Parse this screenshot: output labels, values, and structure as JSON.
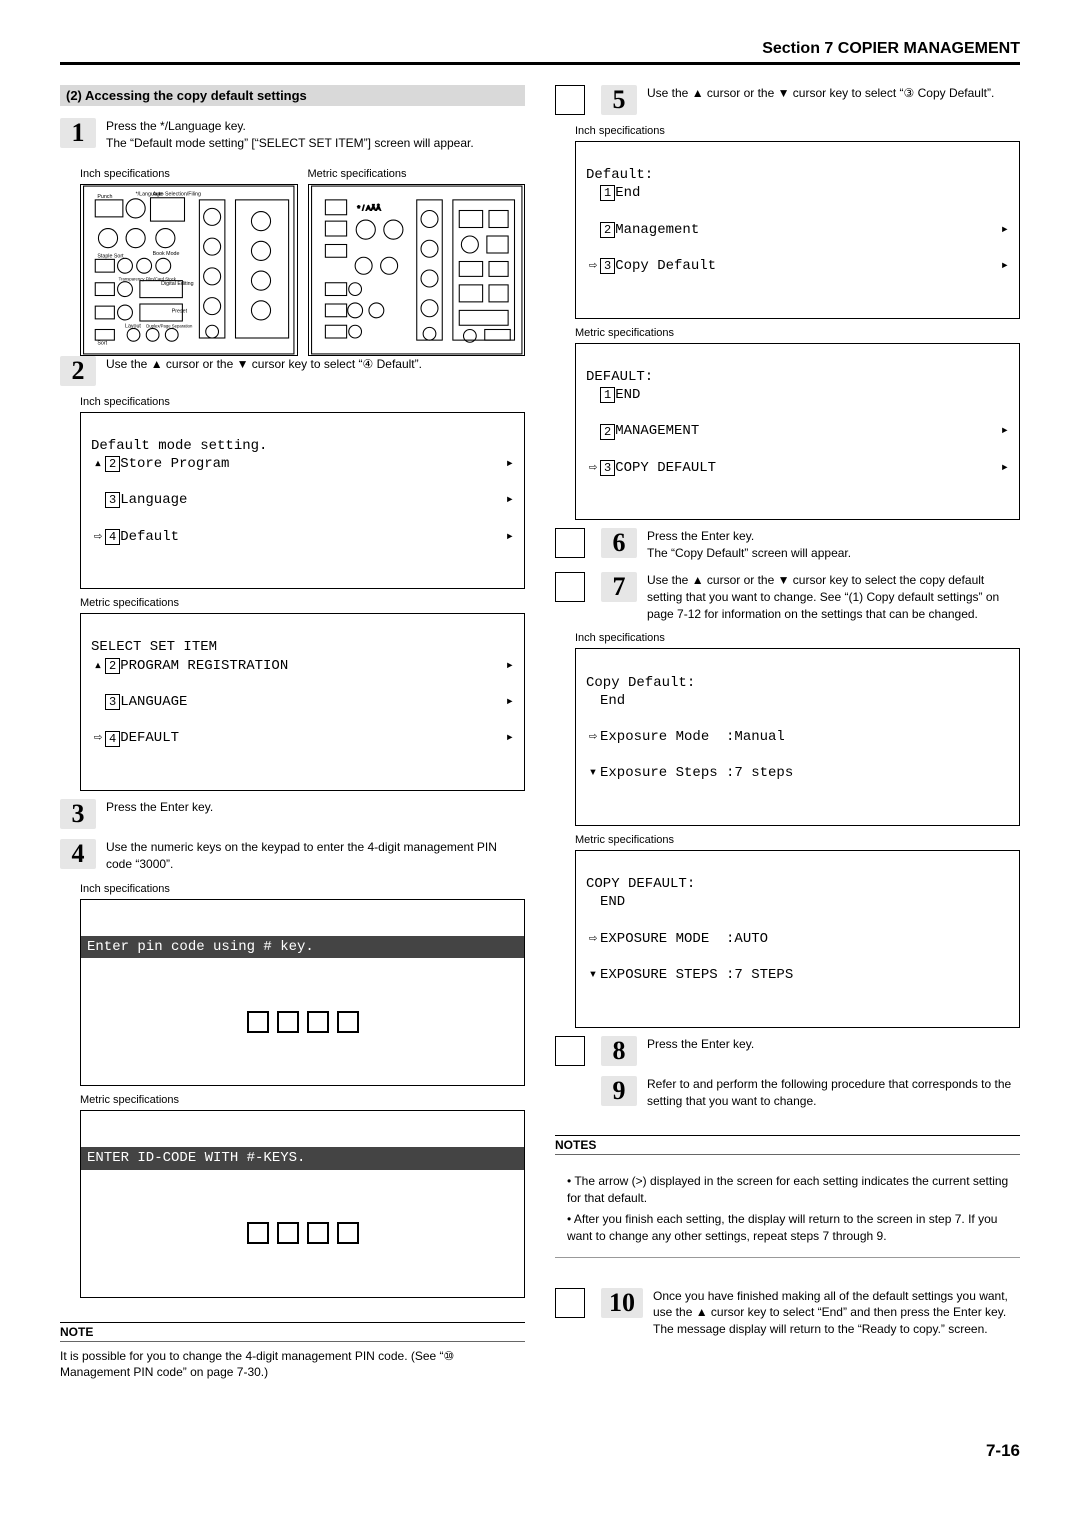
{
  "header": {
    "section": "Section 7  COPIER MANAGEMENT"
  },
  "left": {
    "subsection": "(2)    Accessing the copy default settings",
    "step1": {
      "num": "1",
      "line1": "Press the */Language key.",
      "line2": "The “Default mode setting” [“SELECT SET ITEM”] screen will appear."
    },
    "panels": {
      "inch": "Inch specifications",
      "metric": "Metric specifications"
    },
    "step2": {
      "num": "2",
      "text": "Use the ▲ cursor or the ▼ cursor key to select “④ Default”."
    },
    "lcd2a": {
      "title": "Default mode setting.",
      "r1": "Store Program",
      "r2": "Language",
      "r3": "Default"
    },
    "lcd2b": {
      "title": "SELECT SET ITEM",
      "r1": "PROGRAM REGISTRATION",
      "r2": "LANGUAGE",
      "r3": "DEFAULT"
    },
    "step3": {
      "num": "3",
      "text": "Press the Enter key."
    },
    "step4": {
      "num": "4",
      "text": "Use the numeric keys on the keypad to enter the 4-digit management PIN code “3000”."
    },
    "lcd4a": "Enter pin code using # key.",
    "lcd4b": "ENTER ID-CODE WITH #-KEYS.",
    "note_title": "NOTE",
    "note_text": "It is possible for you to change the 4-digit management PIN code. (See “⑩ Management PIN code” on page 7-30.)"
  },
  "right": {
    "step5": {
      "num": "5",
      "text": "Use the ▲ cursor or the ▼ cursor key to select “③ Copy Default”."
    },
    "lcd5a": {
      "title": "Default:",
      "r1": "End",
      "r2": "Management",
      "r3": "Copy Default"
    },
    "lcd5b": {
      "title": "DEFAULT:",
      "r1": "END",
      "r2": "MANAGEMENT",
      "r3": "COPY DEFAULT"
    },
    "step6": {
      "num": "6",
      "l1": "Press the Enter key.",
      "l2": "The “Copy Default” screen will appear."
    },
    "step7": {
      "num": "7",
      "text": "Use the ▲ cursor or the ▼ cursor key to select the copy default setting that you want to change. See “(1) Copy default settings” on page 7-12 for information on the settings that can be changed."
    },
    "lcd7a": {
      "title": "Copy Default:",
      "r1": "End",
      "r2": "Exposure Mode  :Manual",
      "r3": "Exposure Steps :7 steps"
    },
    "lcd7b": {
      "title": "COPY DEFAULT:",
      "r1": "END",
      "r2": "EXPOSURE MODE  :AUTO",
      "r3": "EXPOSURE STEPS :7 STEPS"
    },
    "step8": {
      "num": "8",
      "text": "Press the Enter key."
    },
    "step9": {
      "num": "9",
      "text": "Refer to and perform the following procedure that corresponds to the setting that you want to change."
    },
    "notes_title": "NOTES",
    "notes": [
      "The arrow (>) displayed in the screen for each setting indicates the current setting for that default.",
      "After you finish each setting, the display will return to the screen in step 7. If you want to change any other settings, repeat steps 7 through 9."
    ],
    "step10": {
      "num": "10",
      "text": "Once you have finished making all of the default settings you want, use the ▲ cursor key to select “End” and then press the Enter key.\nThe message display will return to the “Ready to copy.” screen."
    }
  },
  "footer": "7-16",
  "labels": {
    "inch": "Inch specifications",
    "metric": "Metric specifications"
  }
}
